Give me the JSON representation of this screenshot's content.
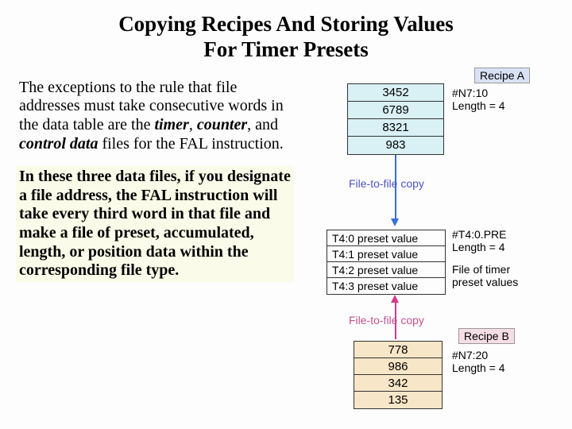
{
  "title_line1": "Copying Recipes And Storing Values",
  "title_line2": "For Timer Presets",
  "para1_lead": "The exceptions to the rule that file addresses must take consecutive words in the data table are the ",
  "para1_kw1": "timer",
  "para1_sep1": ", ",
  "para1_kw2": "counter",
  "para1_sep2": ", and ",
  "para1_kw3": "control data",
  "para1_tail": " files for the FAL instruction.",
  "para2": "In these three data files, if you designate a file address, the FAL instruction will take every third word in that file and make a file of preset, accumulated, length, or position data within the corresponding file type.",
  "recipeA": {
    "tag": "Recipe A",
    "addr": "#N7:10",
    "len": "Length = 4",
    "values": [
      "3452",
      "6789",
      "8321",
      "983"
    ]
  },
  "copyLabelTop": "File-to-file copy",
  "timers": {
    "addr": "#T4:0.PRE",
    "len": "Length = 4",
    "caption_l1": "File of timer",
    "caption_l2": "preset values",
    "rows": [
      "T4:0 preset value",
      "T4:1 preset value",
      "T4:2 preset value",
      "T4:3 preset value"
    ]
  },
  "copyLabelBot": "File-to-file copy",
  "recipeB": {
    "tag": "Recipe B",
    "addr": "#N7:20",
    "len": "Length = 4",
    "values": [
      "778",
      "986",
      "342",
      "135"
    ]
  }
}
